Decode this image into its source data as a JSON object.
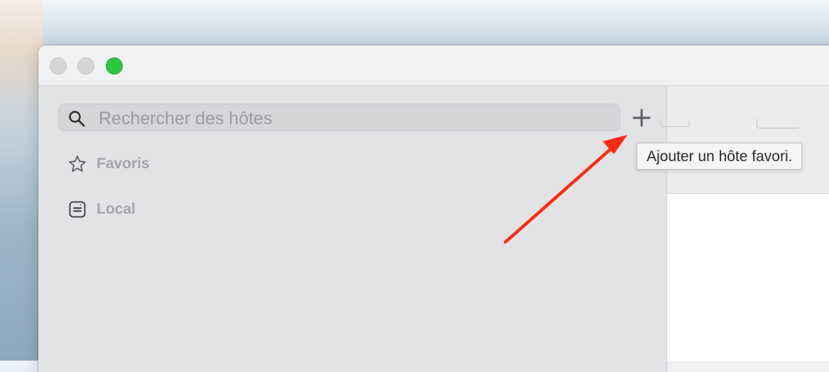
{
  "sidebar": {
    "search": {
      "placeholder": "Rechercher des hôtes",
      "value": ""
    },
    "add_button_icon": "plus-icon",
    "items": [
      {
        "label": "Favoris",
        "icon": "star-icon"
      },
      {
        "label": "Local",
        "icon": "local-network-icon"
      }
    ]
  },
  "tooltip": {
    "text": "Ajouter un hôte favori."
  },
  "annotation": {
    "arrow_color": "#ff2a10"
  },
  "colors": {
    "maximize": "#2ac840",
    "sidebar_bg": "#e2e3e5",
    "nav_label": "#a4a5a8"
  }
}
